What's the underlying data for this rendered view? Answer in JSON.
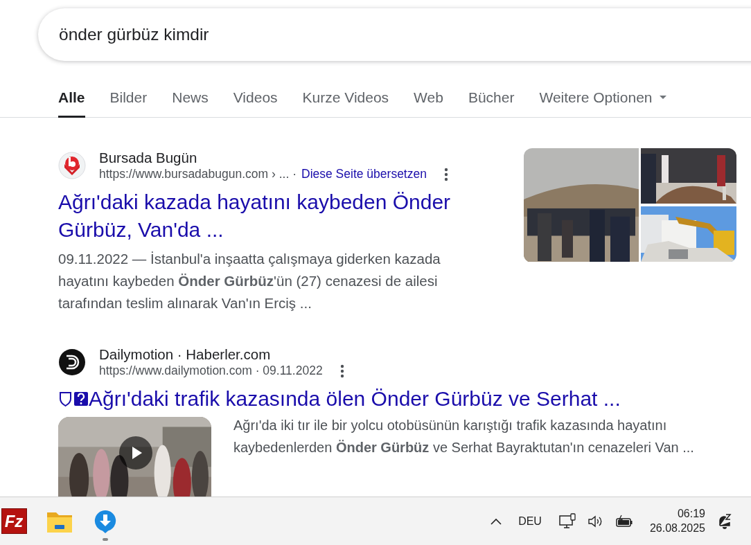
{
  "search": {
    "value": "önder gürbüz kimdir"
  },
  "tabs": [
    {
      "label": "Alle",
      "selected": true,
      "kind": "tab"
    },
    {
      "label": "Bilder",
      "selected": false,
      "kind": "tab"
    },
    {
      "label": "News",
      "selected": false,
      "kind": "tab"
    },
    {
      "label": "Videos",
      "selected": false,
      "kind": "tab"
    },
    {
      "label": "Kurze Videos",
      "selected": false,
      "kind": "tab"
    },
    {
      "label": "Web",
      "selected": false,
      "kind": "tab"
    },
    {
      "label": "Bücher",
      "selected": false,
      "kind": "tab"
    },
    {
      "label": "Weitere Optionen",
      "selected": false,
      "kind": "menu"
    }
  ],
  "results": [
    {
      "kind": "images",
      "site": "Bursada Bugün",
      "url": "https://www.bursadabugun.com › ... ·",
      "translate": "Diese Seite übersetzen",
      "title": "Ağrı'daki kazada hayatını kaybeden Önder Gürbüz, Van'da ...",
      "snippet": "09.11.2022 — İstanbul'a inşaatta çalışmaya giderken kazada hayatını kaybeden **Önder Gürbüz**'ün (27) cenazesi de ailesi tarafından teslim alınarak Van'ın Erciş ..."
    },
    {
      "kind": "video",
      "site": "Dailymotion · Haberler.com",
      "url": "https://www.dailymotion.com · 09.11.2022",
      "title": "Ağrı'daki trafik kazasında ölen Önder Gürbüz ve Serhat ...",
      "snippet": "Ağrı'da iki tır ile bir yolcu otobüsünün karıştığı trafik kazasında hayatını kaybedenlerden **Önder Gürbüz** ve Serhat Bayraktutan'ın cenazeleri Van ..."
    }
  ],
  "taskbar": {
    "apps": [
      {
        "kind": "filezilla",
        "logo_text": "Fz",
        "active": false
      },
      {
        "kind": "folder",
        "active": false
      },
      {
        "kind": "download",
        "active": true
      }
    ],
    "language": "DEU",
    "time": "06:19",
    "date": "26.08.2025"
  }
}
